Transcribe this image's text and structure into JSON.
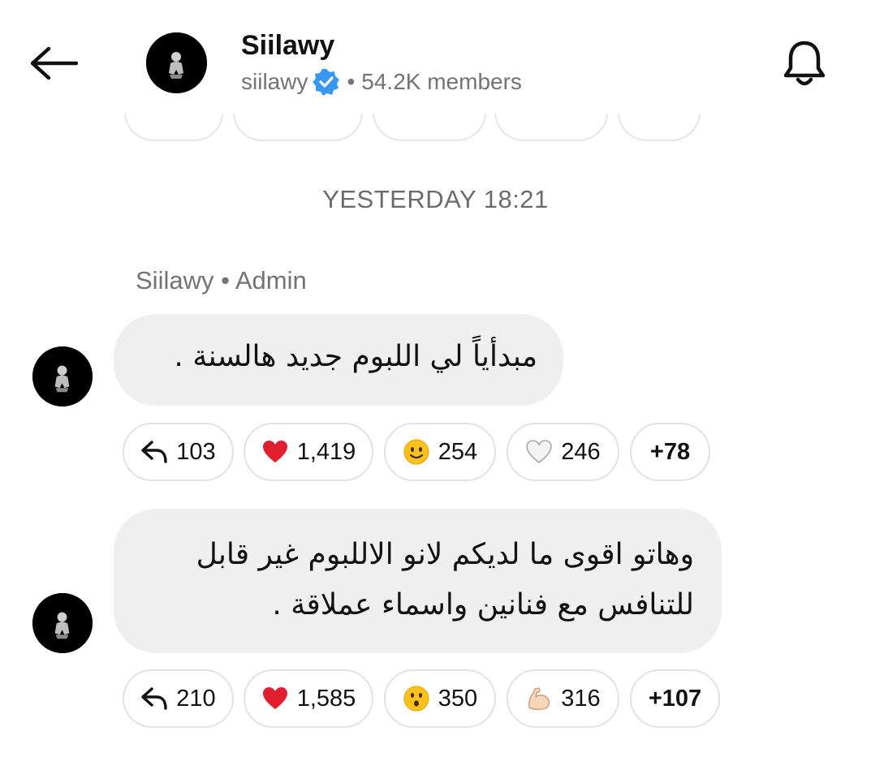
{
  "header": {
    "channel_name": "Siilawy",
    "handle": "siilawy",
    "separator": "•",
    "members": "54.2K members",
    "back_icon": "arrow-left-icon",
    "bell_icon": "bell-icon",
    "verified_icon": "verified-badge-icon"
  },
  "date_separator": "YESTERDAY 18:21",
  "sender": {
    "name": "Siilawy",
    "separator": "•",
    "role": "Admin"
  },
  "messages": [
    {
      "text": "مبدأياً لي اللبوم جديد هالسنة .",
      "reactions": [
        {
          "icon": "reply-icon",
          "count": "103"
        },
        {
          "icon": "red-heart-icon",
          "count": "1,419"
        },
        {
          "icon": "smiling-face-icon",
          "count": "254"
        },
        {
          "icon": "white-heart-icon",
          "count": "246"
        }
      ],
      "more": "+78"
    },
    {
      "text": "وهاتو اقوى ما لديكم لانو الاللبوم غير قابل للتنافس مع فنانين واسماء عملاقة .",
      "reactions": [
        {
          "icon": "reply-icon",
          "count": "210"
        },
        {
          "icon": "red-heart-icon",
          "count": "1,585"
        },
        {
          "icon": "surprised-face-icon",
          "count": "350"
        },
        {
          "icon": "flexed-biceps-icon",
          "count": "316"
        }
      ],
      "more": "+107"
    }
  ],
  "colors": {
    "verified_blue": "#3897f0",
    "bubble_bg": "#efefef",
    "muted_text": "#737373",
    "heart_red": "#e0202e"
  }
}
